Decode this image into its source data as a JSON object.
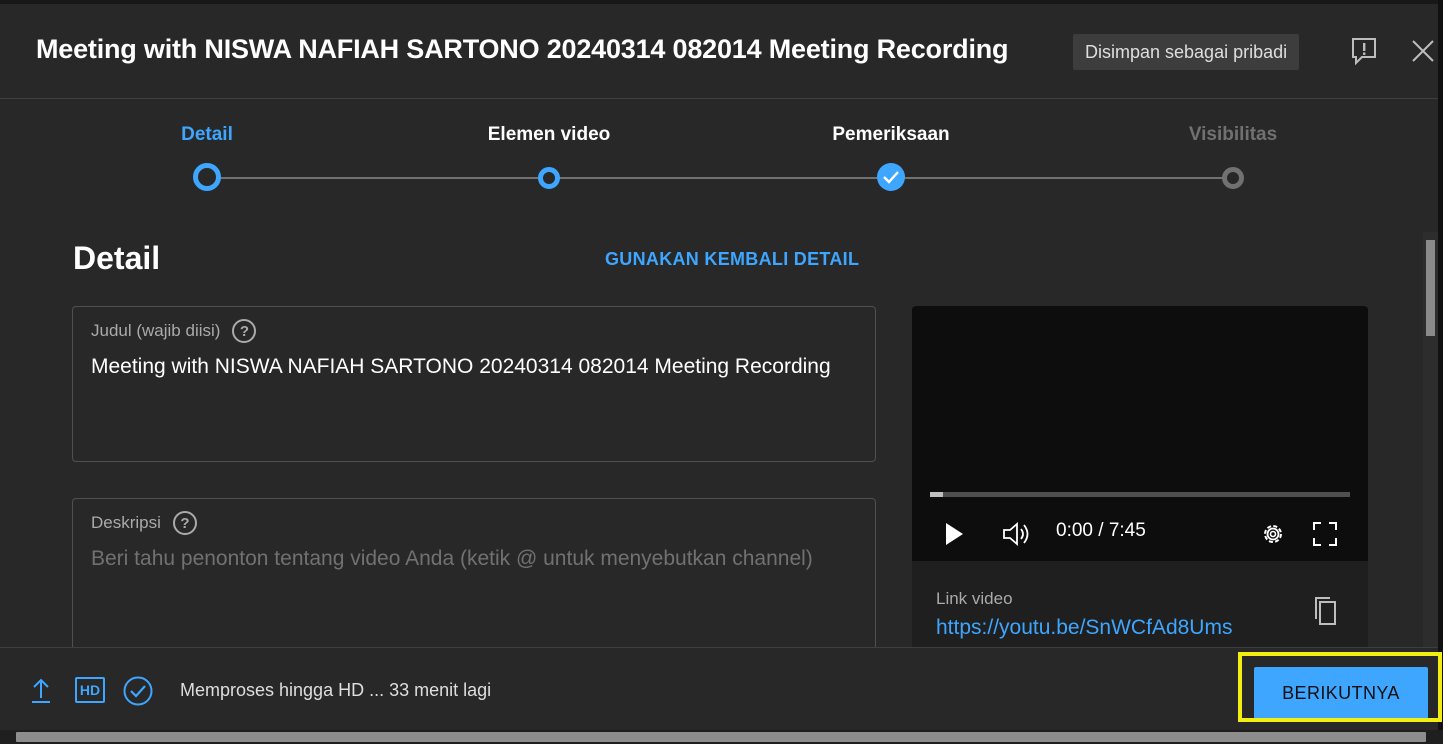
{
  "header": {
    "title": "Meeting with NISWA NAFIAH SARTONO 20240314 082014 Meeting Recording",
    "save_status": "Disimpan sebagai pribadi",
    "feedback_icon": "feedback-icon",
    "close_icon": "close-icon"
  },
  "stepper": {
    "steps": [
      {
        "label": "Detail",
        "state": "active"
      },
      {
        "label": "Elemen video",
        "state": "available"
      },
      {
        "label": "Pemeriksaan",
        "state": "complete"
      },
      {
        "label": "Visibilitas",
        "state": "disabled"
      }
    ]
  },
  "details": {
    "heading": "Detail",
    "reuse_link": "GUNAKAN KEMBALI DETAIL",
    "title_field": {
      "label": "Judul (wajib diisi)",
      "value": "Meeting with NISWA NAFIAH SARTONO 20240314 082014 Meeting Recording"
    },
    "description_field": {
      "label": "Deskripsi",
      "placeholder": "Beri tahu penonton tentang video Anda (ketik @ untuk menyebutkan channel)"
    }
  },
  "preview": {
    "time": "0:00 / 7:45",
    "progress": 0.03,
    "link_label": "Link video",
    "link_url": "https://youtu.be/SnWCfAd8Ums"
  },
  "footer": {
    "status": "Memproses hingga HD ... 33 menit lagi",
    "hd_label": "HD",
    "next_button": "BERIKUTNYA"
  },
  "colors": {
    "accent": "#3ea6ff",
    "background": "#282828",
    "highlight": "#f2ee11"
  }
}
